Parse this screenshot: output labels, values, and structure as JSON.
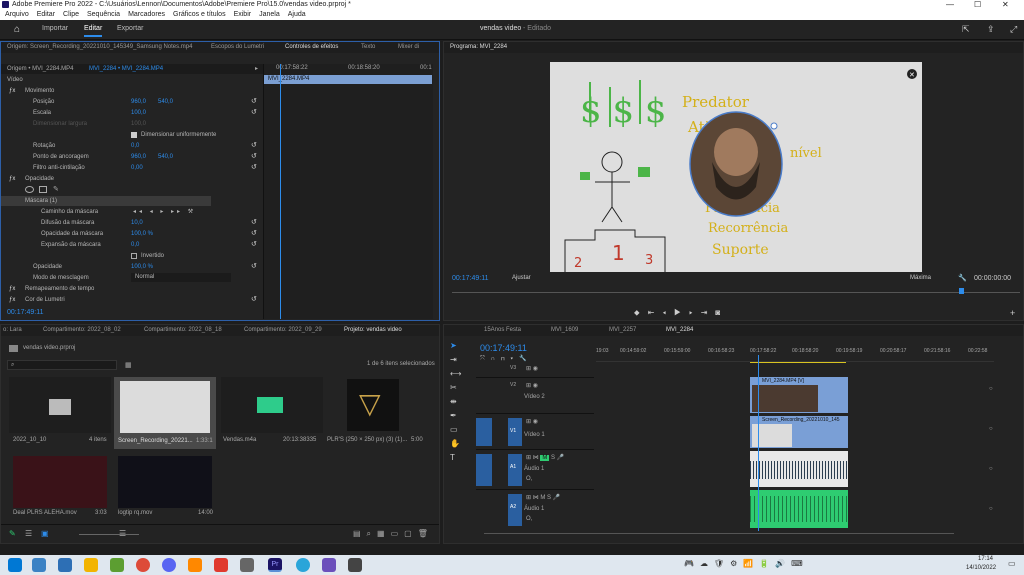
{
  "window": {
    "title": "Adobe Premiere Pro 2022 - C:\\Usuários\\Lennon\\Documentos\\Adobe\\Premiere Pro\\15.0\\vendas video.prproj *"
  },
  "menu": [
    "Arquivo",
    "Editar",
    "Clipe",
    "Sequência",
    "Marcadores",
    "Gráficos e títulos",
    "Exibir",
    "Janela",
    "Ajuda"
  ],
  "topbar": {
    "tabs": [
      "Importar",
      "Editar",
      "Exportar"
    ],
    "project_name": "vendas video",
    "status": "- Editado"
  },
  "source_panel": {
    "tabs": [
      "Origem: Screen_Recording_20221010_145349_Samsung Notes.mp4",
      "Escopos do Lumetri",
      "Controles de efeitos",
      "Texto",
      "Mixer di"
    ],
    "clip_select": "Origem • MVI_2284.MP4",
    "sequence_select": "MVI_2284 • MVI_2284.MP4",
    "timecodes": [
      "00:17:58:22",
      "00:18:58:20",
      "00:1"
    ],
    "clip_label": "MVI_2284.MP4",
    "rows": [
      {
        "label": "Vídeo",
        "v1": "",
        "v2": ""
      },
      {
        "label": "Movimento",
        "v1": "",
        "v2": ""
      },
      {
        "label": "Posição",
        "v1": "960,0",
        "v2": "540,0"
      },
      {
        "label": "Escala",
        "v1": "100,0",
        "v2": ""
      },
      {
        "label": "Dimensionar largura",
        "v1": "100,0",
        "v2": ""
      },
      {
        "label": "Dimensionar uniformemente",
        "v1": "",
        "v2": ""
      },
      {
        "label": "Rotação",
        "v1": "0,0",
        "v2": ""
      },
      {
        "label": "Ponto de ancoragem",
        "v1": "960,0",
        "v2": "540,0"
      },
      {
        "label": "Filtro anti-cintilação",
        "v1": "0,00",
        "v2": ""
      },
      {
        "label": "Opacidade",
        "v1": "",
        "v2": ""
      },
      {
        "label": "Máscara (1)",
        "v1": "",
        "v2": ""
      },
      {
        "label": "Caminho da máscara",
        "v1": "",
        "v2": ""
      },
      {
        "label": "Difusão da máscara",
        "v1": "10,0",
        "v2": ""
      },
      {
        "label": "Opacidade da máscara",
        "v1": "100,0 %",
        "v2": ""
      },
      {
        "label": "Expansão da máscara",
        "v1": "0,0",
        "v2": ""
      },
      {
        "label": "Invertido",
        "v1": "",
        "v2": ""
      },
      {
        "label": "Opacidade",
        "v1": "100,0 %",
        "v2": ""
      },
      {
        "label": "Modo de mesclagem",
        "v1": "Normal",
        "v2": ""
      },
      {
        "label": "Remapeamento de tempo",
        "v1": "",
        "v2": ""
      },
      {
        "label": "Cor de Lumetri",
        "v1": "",
        "v2": ""
      }
    ],
    "current_time": "00:17:49:11"
  },
  "program": {
    "tab": "Programa: MVI_2284",
    "timecode": "00:17:49:11",
    "fit": "Ajustar",
    "quality": "Máxima",
    "duration": "00:00:00:00",
    "drawing_text": [
      "Predator",
      "Atividade",
      "nível",
      "Frequência",
      "Recorrência",
      "Suporte"
    ],
    "money": "$ $ $"
  },
  "project": {
    "tabs": [
      "o: Lara",
      "Compartimento: 2022_08_02",
      "Compartimento: 2022_08_18",
      "Compartimento: 2022_09_29",
      "Projeto: vendas video"
    ],
    "path": "vendas video.prproj",
    "selection": "1 de 6 itens selecionados",
    "items": [
      {
        "name": "2022_10_10",
        "meta": "4 itens"
      },
      {
        "name": "Screen_Recording_20221...",
        "meta": "1:33:1"
      },
      {
        "name": "Vendas.m4a",
        "meta": ""
      },
      {
        "name": "20:13:38335",
        "meta": ""
      },
      {
        "name": "PLR'S (250 × 250 px) (3) (1)...",
        "meta": "5:00"
      },
      {
        "name": "Deal PLRS ALEHA.mov",
        "meta": "3:03"
      },
      {
        "name": "logtip rq.mov",
        "meta": "14:00"
      }
    ]
  },
  "timeline": {
    "tabs": [
      "15Anos Festa",
      "MVI_1609",
      "MVI_2257",
      "MVI_2284"
    ],
    "timecode": "00:17:49:11",
    "ruler": [
      "19:03",
      "00:14:59:02",
      "00:15:59:00",
      "00:16:58:23",
      "00:17:58:22",
      "00:18:58:20",
      "00:19:58:19",
      "00:20:58:17",
      "00:21:58:16",
      "00:22:58"
    ],
    "tracks": [
      {
        "id": "V3",
        "name": ""
      },
      {
        "id": "V2",
        "name": "Vídeo 2"
      },
      {
        "id": "V1",
        "name": "Vídeo 1"
      },
      {
        "id": "A1",
        "name": "Áudio 1"
      },
      {
        "id": "A2",
        "name": "Áudio 1"
      }
    ],
    "clips": [
      "MVI_2284.MP4 [V]",
      "Screen_Recording_20221010_145"
    ]
  },
  "taskbar": {
    "time": "17:14",
    "date": "14/10/2022"
  }
}
